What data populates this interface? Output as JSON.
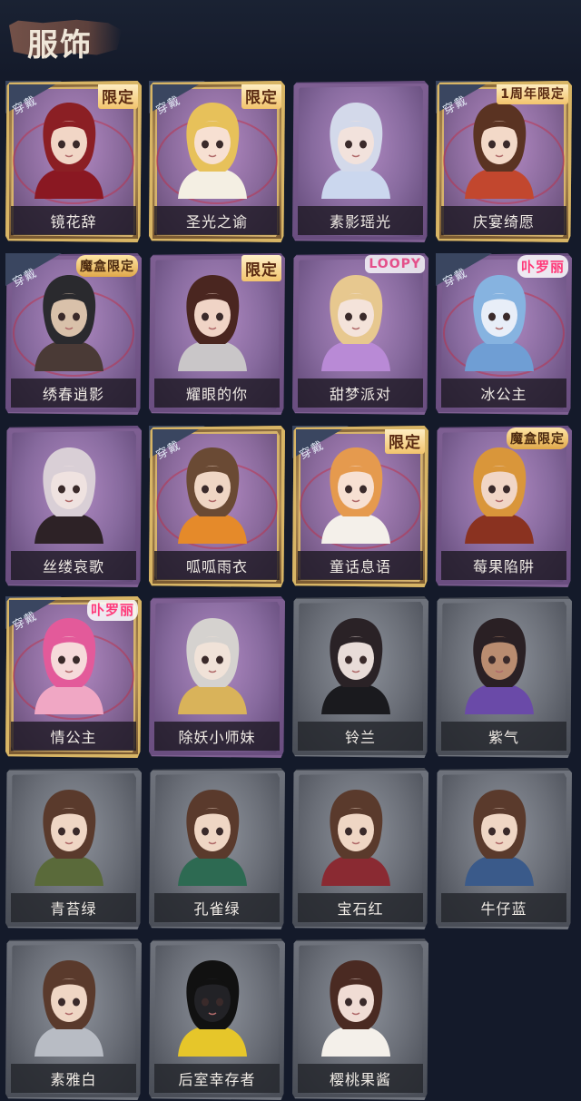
{
  "header": {
    "title": "服饰"
  },
  "colors": {
    "background": "#141a2a",
    "gold": "#d8b565",
    "purple": "#7e5f92",
    "gray": "#6f737c"
  },
  "outfits": [
    {
      "name": "镜花辞",
      "rarity": "gold",
      "worn": true,
      "tag": "限定",
      "tag_style": "limited",
      "hair": "#8b1f24",
      "skin": "#f1d6c6",
      "cloth": "#8a1822"
    },
    {
      "name": "圣光之谕",
      "rarity": "gold",
      "worn": true,
      "tag": "限定",
      "tag_style": "limited",
      "hair": "#e7c15a",
      "skin": "#f7e0d2",
      "cloth": "#f4efe3"
    },
    {
      "name": "素影瑶光",
      "rarity": "purple",
      "worn": false,
      "tag": "",
      "tag_style": "",
      "hair": "#d3d9ea",
      "skin": "#f2e2dc",
      "cloth": "#cbd7ee"
    },
    {
      "name": "庆宴绮愿",
      "rarity": "gold",
      "worn": true,
      "tag": "1周年限定",
      "tag_style": "anniv",
      "hair": "#5a3322",
      "skin": "#f3d9c8",
      "cloth": "#c2472e"
    },
    {
      "name": "绣春逍影",
      "rarity": "purple",
      "worn": true,
      "tag": "魔盒限定",
      "tag_style": "boxlimited",
      "hair": "#2a2a2e",
      "skin": "#d9c1aa",
      "cloth": "#4a3a36"
    },
    {
      "name": "耀眼的你",
      "rarity": "purple",
      "worn": false,
      "tag": "限定",
      "tag_style": "limited",
      "hair": "#4a2620",
      "skin": "#f0d4c6",
      "cloth": "#c9c6c8"
    },
    {
      "name": "甜梦派对",
      "rarity": "purple",
      "worn": false,
      "tag": "LOOPY",
      "tag_style": "collab-loop",
      "hair": "#e7c88f",
      "skin": "#f4e3da",
      "cloth": "#b98ad6"
    },
    {
      "name": "冰公主",
      "rarity": "purple",
      "worn": true,
      "tag": "卟罗丽",
      "tag_style": "collab-pink",
      "hair": "#86b3e0",
      "skin": "#e8eef8",
      "cloth": "#6f9ed4"
    },
    {
      "name": "丝缕哀歌",
      "rarity": "purple",
      "worn": false,
      "tag": "",
      "tag_style": "",
      "hair": "#d9cfd6",
      "skin": "#efe2e0",
      "cloth": "#2d2226"
    },
    {
      "name": "呱呱雨衣",
      "rarity": "gold",
      "worn": true,
      "tag": "",
      "tag_style": "",
      "hair": "#6a4a34",
      "skin": "#efd6c4",
      "cloth": "#e58a2a"
    },
    {
      "name": "童话息语",
      "rarity": "gold",
      "worn": true,
      "tag": "限定",
      "tag_style": "limited",
      "hair": "#e59a4e",
      "skin": "#f7e0d2",
      "cloth": "#f4f0ea"
    },
    {
      "name": "莓果陷阱",
      "rarity": "purple",
      "worn": false,
      "tag": "魔盒限定",
      "tag_style": "boxlimited",
      "hair": "#d9963a",
      "skin": "#f1d6c6",
      "cloth": "#8a3220"
    },
    {
      "name": "情公主",
      "rarity": "gold",
      "worn": true,
      "tag": "卟罗丽",
      "tag_style": "collab-pink",
      "hair": "#e35a9a",
      "skin": "#f6dada",
      "cloth": "#f0a7c4"
    },
    {
      "name": "除妖小师妹",
      "rarity": "purple",
      "worn": false,
      "tag": "",
      "tag_style": "",
      "hair": "#d5d2cf",
      "skin": "#f0e2d8",
      "cloth": "#d9b35a"
    },
    {
      "name": "铃兰",
      "rarity": "gray",
      "worn": false,
      "tag": "",
      "tag_style": "",
      "hair": "#2a2226",
      "skin": "#e8dcd8",
      "cloth": "#1a1a1e"
    },
    {
      "name": "紫气",
      "rarity": "gray",
      "worn": false,
      "tag": "",
      "tag_style": "",
      "hair": "#2a2024",
      "skin": "#b98c70",
      "cloth": "#6a4aa8"
    },
    {
      "name": "青苔绿",
      "rarity": "gray",
      "worn": false,
      "tag": "",
      "tag_style": "",
      "hair": "#5a3a2c",
      "skin": "#efd6c4",
      "cloth": "#5a6a3a"
    },
    {
      "name": "孔雀绿",
      "rarity": "gray",
      "worn": false,
      "tag": "",
      "tag_style": "",
      "hair": "#5a3a2c",
      "skin": "#efd6c4",
      "cloth": "#2d6a52"
    },
    {
      "name": "宝石红",
      "rarity": "gray",
      "worn": false,
      "tag": "",
      "tag_style": "",
      "hair": "#5a3a2c",
      "skin": "#efd6c4",
      "cloth": "#8a2a32"
    },
    {
      "name": "牛仔蓝",
      "rarity": "gray",
      "worn": false,
      "tag": "",
      "tag_style": "",
      "hair": "#5a3a2c",
      "skin": "#efd6c4",
      "cloth": "#3a5a8a"
    },
    {
      "name": "素雅白",
      "rarity": "gray",
      "worn": false,
      "tag": "",
      "tag_style": "",
      "hair": "#5a3a2c",
      "skin": "#efd6c4",
      "cloth": "#b8bcc4"
    },
    {
      "name": "后室幸存者",
      "rarity": "gray",
      "worn": false,
      "tag": "",
      "tag_style": "",
      "hair": "#111111",
      "skin": "#222226",
      "cloth": "#e6c62a"
    },
    {
      "name": "樱桃果酱",
      "rarity": "gray",
      "worn": false,
      "tag": "",
      "tag_style": "",
      "hair": "#4a2a22",
      "skin": "#f0dcd4",
      "cloth": "#f4f0ea"
    }
  ],
  "wear_label": "穿戴"
}
